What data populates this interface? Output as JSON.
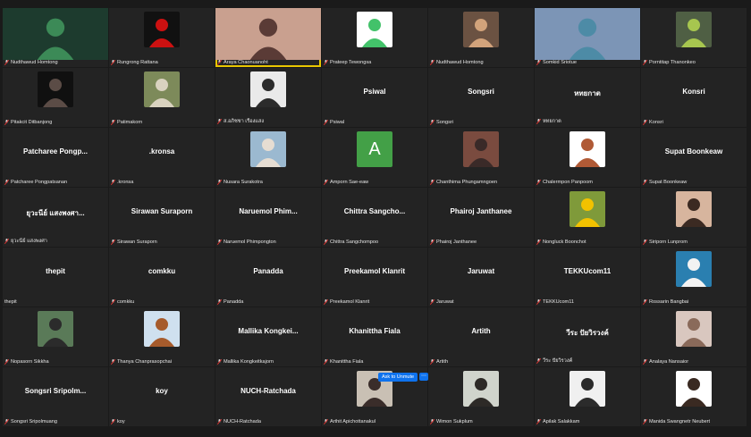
{
  "tiles": [
    {
      "name": "Nudthawud Homtong",
      "muted": true,
      "kind": "photo",
      "bg": "#1d3b2e",
      "fg": "#3c8a57",
      "wide": true
    },
    {
      "name": "Rungrong Rattana",
      "muted": true,
      "kind": "photo",
      "bg": "#111111",
      "fg": "#cc1111"
    },
    {
      "name": "Araya Chaonuanoht",
      "muted": true,
      "kind": "photo",
      "bg": "#c9a08f",
      "fg": "#5a3b36",
      "wide": true,
      "active": true
    },
    {
      "name": "Prateep Tewongsa",
      "muted": true,
      "kind": "photo",
      "bg": "#ffffff",
      "fg": "#43c26a"
    },
    {
      "name": "Nudthawud Homtong",
      "muted": true,
      "kind": "photo",
      "bg": "#6b5242",
      "fg": "#d2a37b"
    },
    {
      "name": "Somkid Sriotue",
      "muted": true,
      "kind": "photo",
      "bg": "#7c95b6",
      "fg": "#4d8ba6",
      "wide": true
    },
    {
      "name": "Porntitap Thanonkeo",
      "muted": true,
      "kind": "photo",
      "bg": "#4f5f44",
      "fg": "#a7c64f"
    },
    {
      "name": "Pitakcit Ditbanjong",
      "muted": true,
      "kind": "photo",
      "bg": "#101010",
      "fg": "#5b4c46"
    },
    {
      "name": "Patimakorn",
      "muted": true,
      "kind": "photo",
      "bg": "#7d8a5a",
      "fg": "#d9d2bf"
    },
    {
      "name": "ส.อภิชชา เรืองแสง",
      "muted": true,
      "kind": "photo",
      "bg": "#eaeaea",
      "fg": "#2b2b2b"
    },
    {
      "name": "Psiwal",
      "muted": true,
      "kind": "text",
      "display": "Psiwal"
    },
    {
      "name": "Songsri",
      "muted": true,
      "kind": "text",
      "display": "Songsri"
    },
    {
      "name": "หทยกาต",
      "muted": true,
      "kind": "text",
      "display": "หทยกาต"
    },
    {
      "name": "Konsri",
      "muted": true,
      "kind": "text",
      "display": "Konsri"
    },
    {
      "name": "Patcharee Pongpatsanan",
      "muted": true,
      "kind": "text",
      "display": "Patcharee  Pongp..."
    },
    {
      "name": ".kronsa",
      "muted": true,
      "kind": "text",
      "display": ".kronsa"
    },
    {
      "name": "Nusara Surakotra",
      "muted": true,
      "kind": "photo",
      "bg": "#9bb9d0",
      "fg": "#e6ddd2"
    },
    {
      "name": "Amporn Sae-eaw",
      "muted": true,
      "kind": "letter",
      "letter": "A"
    },
    {
      "name": "Chanthima Phungamngoen",
      "muted": true,
      "kind": "photo",
      "bg": "#7a4b3f",
      "fg": "#3a2a28"
    },
    {
      "name": "Chalermpon Panpoom",
      "muted": true,
      "kind": "photo",
      "bg": "#ffffff",
      "fg": "#b05a36"
    },
    {
      "name": "Supat Boonkeaw",
      "muted": true,
      "kind": "text",
      "display": "Supat Boonkeaw"
    },
    {
      "name": "ยุวะนีย์ แสงพงศา",
      "muted": true,
      "kind": "text",
      "display": "ยุวะนีย์ แสงพงศา..."
    },
    {
      "name": "Sirawan Suraporn",
      "muted": true,
      "kind": "text",
      "display": "Sirawan  Suraporn"
    },
    {
      "name": "Naruemol Phimpongton",
      "muted": true,
      "kind": "text",
      "display": "Naruemol  Phim..."
    },
    {
      "name": "Chittra Sangchompoo",
      "muted": true,
      "kind": "text",
      "display": "Chittra  Sangcho..."
    },
    {
      "name": "Phairoj Janthanee",
      "muted": true,
      "kind": "text",
      "display": "Phairoj Janthanee"
    },
    {
      "name": "Nongluck Boonchot",
      "muted": true,
      "kind": "photo",
      "bg": "#7f9a3a",
      "fg": "#f2c200"
    },
    {
      "name": "Siriporn Lunprom",
      "muted": true,
      "kind": "photo",
      "bg": "#d7b59e",
      "fg": "#3b2a22"
    },
    {
      "name": "thepit",
      "muted": false,
      "kind": "text",
      "display": "thepit"
    },
    {
      "name": "comkku",
      "muted": true,
      "kind": "text",
      "display": "comkku"
    },
    {
      "name": "Panadda",
      "muted": true,
      "kind": "text",
      "display": "Panadda"
    },
    {
      "name": "Preekamol Klanrit",
      "muted": true,
      "kind": "text",
      "display": "Preekamol Klanrit"
    },
    {
      "name": "Jaruwat",
      "muted": true,
      "kind": "text",
      "display": "Jaruwat"
    },
    {
      "name": "TEKKUcom11",
      "muted": true,
      "kind": "text",
      "display": "TEKKUcom11"
    },
    {
      "name": "Rossarin Bangbai",
      "muted": true,
      "kind": "photo",
      "bg": "#2a7fb0",
      "fg": "#f2f2f2"
    },
    {
      "name": "Nopasorn Sikkha",
      "muted": true,
      "kind": "photo",
      "bg": "#5a7a58",
      "fg": "#2b2b2b"
    },
    {
      "name": "Thanya Chanprasopchai",
      "muted": true,
      "kind": "photo",
      "bg": "#cfe0ef",
      "fg": "#a65b2c"
    },
    {
      "name": "Mallika Kongkeitkajorn",
      "muted": true,
      "kind": "text",
      "display": "Mallika  Kongkei..."
    },
    {
      "name": "Khanittha Fiala",
      "muted": true,
      "kind": "text",
      "display": "Khanittha  Fiala"
    },
    {
      "name": "Artith",
      "muted": true,
      "kind": "text",
      "display": "Artith"
    },
    {
      "name": "วีระ ปัยวิรวงค์",
      "muted": true,
      "kind": "text",
      "display": "วีระ  ปัยวิรวงค์"
    },
    {
      "name": "Analaya Nansaior",
      "muted": true,
      "kind": "photo",
      "bg": "#d9c7bf",
      "fg": "#8a6a5a"
    },
    {
      "name": "Songsri Sripolmuang",
      "muted": true,
      "kind": "text",
      "display": "Songsri  Sripolm..."
    },
    {
      "name": "koy",
      "muted": true,
      "kind": "text",
      "display": "koy"
    },
    {
      "name": "NUCH-Ratchada",
      "muted": true,
      "kind": "text",
      "display": "NUCH-Ratchada"
    },
    {
      "name": "Arthit Apichottanakul",
      "muted": true,
      "kind": "photo",
      "bg": "#c9c0b4",
      "fg": "#3a2d2a"
    },
    {
      "name": "Wimon Sukplum",
      "muted": true,
      "kind": "photo",
      "bg": "#d0d4cc",
      "fg": "#2d2a27"
    },
    {
      "name": "Apilak Salakkam",
      "muted": true,
      "kind": "photo",
      "bg": "#f0f0f0",
      "fg": "#2b2b2b"
    },
    {
      "name": "Manida Swangnetr Neubert",
      "muted": true,
      "kind": "photo",
      "bg": "#ffffff",
      "fg": "#3a2a22"
    }
  ],
  "unmute": {
    "label": "Ask to Unmute",
    "more": "⋯"
  }
}
